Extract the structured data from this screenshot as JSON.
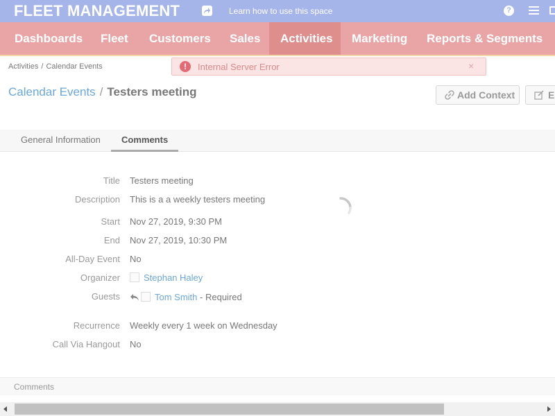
{
  "header": {
    "brand": "FLEET MANAGEMENT",
    "learn_link": "Learn how to use this space",
    "help_label": "?",
    "share_icon": "share-icon",
    "menu_icon": "hamburger-menu-icon",
    "mail_icon": "mail-icon",
    "color": "#a5b4e9"
  },
  "nav": {
    "color": "#e9a5a5",
    "active_color": "#df8e8e",
    "items": [
      {
        "label": "Dashboards",
        "active": false
      },
      {
        "label": "Fleet",
        "active": false
      },
      {
        "label": "Customers",
        "active": false
      },
      {
        "label": "Sales",
        "active": false
      },
      {
        "label": "Activities",
        "active": true
      },
      {
        "label": "Marketing",
        "active": false
      },
      {
        "label": "Reports & Segments",
        "active": false
      }
    ]
  },
  "breadcrumb": [
    "Activities",
    "Calendar Events"
  ],
  "error": {
    "icon": "!",
    "message": "Internal Server Error",
    "close": "×"
  },
  "page": {
    "parent": "Calendar Events",
    "separator": "/",
    "title": "Testers meeting"
  },
  "actions": {
    "add_context": "Add Context",
    "edit": "Edit"
  },
  "tabs": [
    {
      "label": "General Information",
      "active": false
    },
    {
      "label": "Comments",
      "active": true
    }
  ],
  "fields": {
    "title": {
      "label": "Title",
      "value": "Testers meeting"
    },
    "description": {
      "label": "Description",
      "value": "This is a a weekly testers meeting"
    },
    "start": {
      "label": "Start",
      "value": "Nov 27, 2019, 9:30 PM"
    },
    "end": {
      "label": "End",
      "value": "Nov 27, 2019, 10:30 PM"
    },
    "all_day": {
      "label": "All-Day Event",
      "value": "No"
    },
    "organizer": {
      "label": "Organizer",
      "value": "Stephan Haley"
    },
    "guests": {
      "label": "Guests",
      "name": "Tom Smith",
      "suffix": "- Required"
    },
    "recurrence": {
      "label": "Recurrence",
      "value": "Weekly every 1 week on Wednesday"
    },
    "hangout": {
      "label": "Call Via Hangout",
      "value": "No"
    }
  },
  "comments_section": {
    "label": "Comments"
  }
}
